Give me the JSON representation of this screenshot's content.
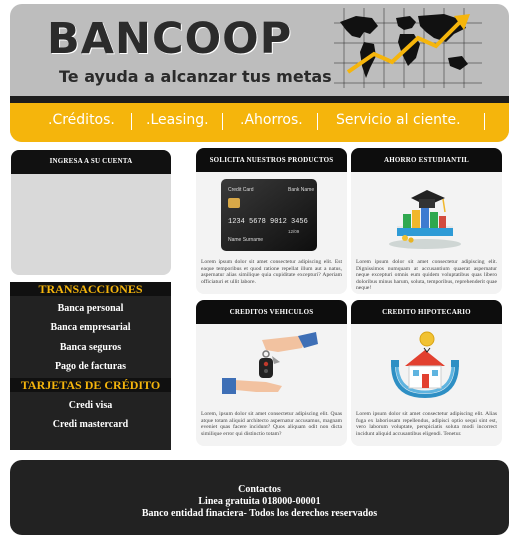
{
  "header": {
    "brand": "BANCOOP",
    "slogan": "Te ayuda a alcanzar tus metas",
    "logo_icon": "world-map-growth-icon"
  },
  "nav": {
    "items": [
      ".Créditos.",
      ".Leasing.",
      ".Ahorros.",
      "Servicio al ciente."
    ]
  },
  "login": {
    "title": "INGRESA A SU CUENTA"
  },
  "menu": {
    "transacciones_title": "TRANSACCIONES",
    "transacciones": [
      "Banca personal",
      "Banca empresarial",
      "Banca seguros",
      "Pago de facturas"
    ],
    "tarjetas_title": "TARJETAS DE CRÉDITO",
    "tarjetas": [
      "Credi visa",
      "Credi mastercard"
    ]
  },
  "cards": [
    {
      "title": "SOLICITA NUESTROS PRODUCTOS",
      "icon": "credit-card-icon",
      "card_label": "Credit Card",
      "card_bank": "Bank Name",
      "card_number": "1234 5678 9012 3456",
      "card_expiry": "12/09",
      "card_holder": "Name Surname",
      "text": "Lorem ipsum dolor sit amet consectetur adipiscing elit. Est eaque temporibus et quod ratione repellat illum aut a natus, aspernatur alias similique quia cupiditate excepturi? Aperiam officiaturi et ullit labore."
    },
    {
      "title": "AHORRO ESTUDIANTIL",
      "icon": "graduation-books-icon",
      "text": "Lorem ipsum dolor sit amet consectetur adipiscing elit. Dignissimos numquam at accusantium quaerat aspernatur neque excepturi omnis eum quidem voluptatibus quas libero doloribus minus harum, soluta, temporibus, reprehenderit quae neque!"
    },
    {
      "title": "CREDITOS VEHICULOS",
      "icon": "car-key-hands-icon",
      "text": "Lorem, ipsum dolor sit amet consectetur adipiscing elit. Quas atque totam aliquid architecto aspernatur accusamus, magnam eveniet quas facere incidunt? Quos aliquam odit non dicta similique error qui distinctio totam?"
    },
    {
      "title": "CREDITO HIPOTECARIO",
      "icon": "house-coin-icon",
      "text": "Lorem ipsum dolor sit amet consectetur adipiscing elit. Alias fuga ex laboriosam repellendus, adipisci optio sequi sint est, vero laborum voluptate, perspiciatis soluta modi incorrect incidunt aliquid accusantibus eligendi. Tenetur."
    }
  ],
  "footer": {
    "line1": "Contactos",
    "line2": "Linea gratuita 018000-00001",
    "line3": "Banco entidad finaciera- Todos los derechos reservados"
  },
  "colors": {
    "accent": "#f5b50c",
    "dark": "#222222",
    "header_bg": "#bdbdbd"
  }
}
